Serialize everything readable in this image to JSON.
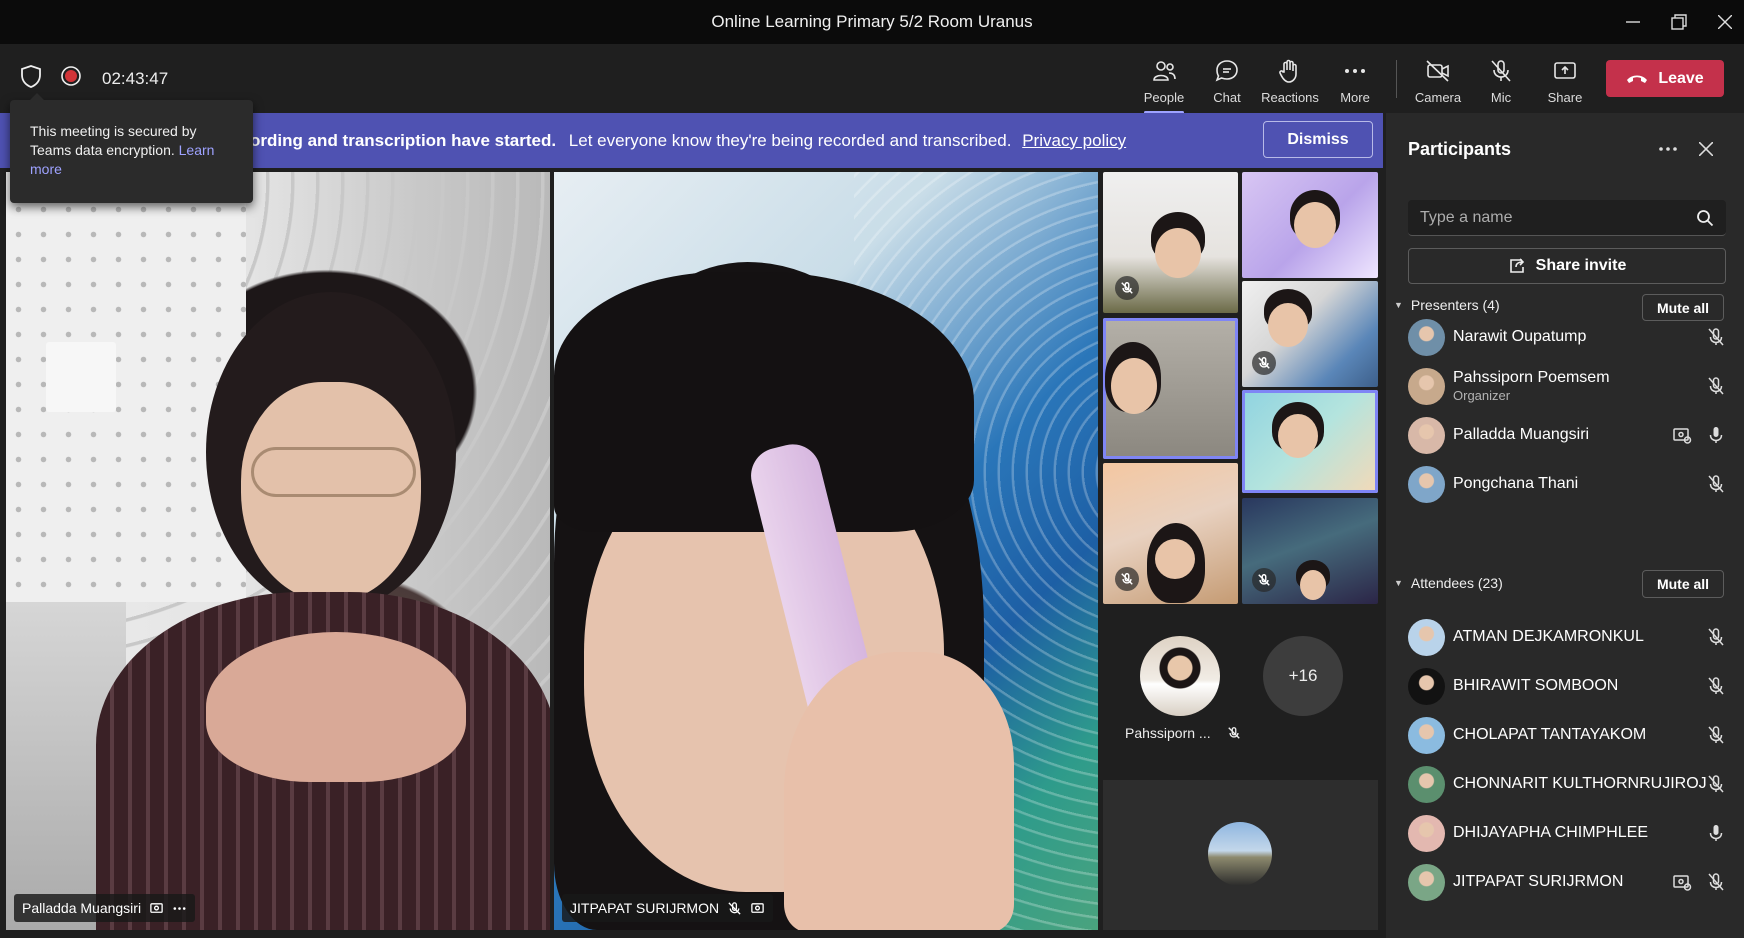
{
  "window": {
    "title": "Online Learning Primary 5/2 Room Uranus"
  },
  "toolbar": {
    "timer": "02:43:47",
    "buttons": {
      "people": "People",
      "chat": "Chat",
      "reactions": "Reactions",
      "more": "More",
      "camera": "Camera",
      "mic": "Mic",
      "share": "Share"
    },
    "leave": "Leave"
  },
  "tooltip": {
    "text": "This meeting is secured by Teams data encryption.",
    "link": "Learn more"
  },
  "banner": {
    "bold": "ording and transcription have started.",
    "text": "Let everyone know they're being recorded and transcribed.",
    "link": "Privacy policy",
    "dismiss": "Dismiss"
  },
  "stage": {
    "main_left_name": "Palladda Muangsiri",
    "main_right_name": "JITPAPAT SURIJRMON",
    "overflow_name": "Pahssiporn ...",
    "overflow_count": "+16"
  },
  "participants": {
    "title": "Participants",
    "search_placeholder": "Type a name",
    "share_invite": "Share invite",
    "presenters": {
      "header": "Presenters (4)",
      "mute_all": "Mute all",
      "people": [
        {
          "name": "Narawit Oupatump",
          "role": "",
          "mic": "muted",
          "share": false,
          "avatar_color": "#6f8fa8"
        },
        {
          "name": "Pahssiporn Poemsem",
          "role": "Organizer",
          "mic": "muted",
          "share": false,
          "avatar_color": "#c7a98c"
        },
        {
          "name": "Palladda Muangsiri",
          "role": "",
          "mic": "on",
          "share": true,
          "avatar_color": "#d8b8a8"
        },
        {
          "name": "Pongchana Thani",
          "role": "",
          "mic": "muted",
          "share": false,
          "avatar_color": "#7fa6c9"
        }
      ]
    },
    "attendees": {
      "header": "Attendees (23)",
      "mute_all": "Mute all",
      "people": [
        {
          "name": "ATMAN DEJKAMRONKUL",
          "mic": "muted",
          "share": false,
          "avatar_color": "#b9d3ea"
        },
        {
          "name": "BHIRAWIT SOMBOON",
          "mic": "muted",
          "share": false,
          "avatar_color": "#121212"
        },
        {
          "name": "CHOLAPAT TANTAYAKOM",
          "mic": "muted",
          "share": false,
          "avatar_color": "#8bbbe0"
        },
        {
          "name": "CHONNARIT KULTHORNRUJIROJ",
          "mic": "muted",
          "share": false,
          "avatar_color": "#5b8f6e"
        },
        {
          "name": "DHIJAYAPHA CHIMPHLEE",
          "mic": "on",
          "share": false,
          "avatar_color": "#e3b8b0"
        },
        {
          "name": "JITPAPAT SURIJRMON",
          "mic": "muted",
          "share": true,
          "avatar_color": "#7aa686"
        }
      ]
    }
  },
  "colors": {
    "accent": "#4f52b2",
    "leave": "#c4314b",
    "speaking_outline": "#7f85f5"
  }
}
